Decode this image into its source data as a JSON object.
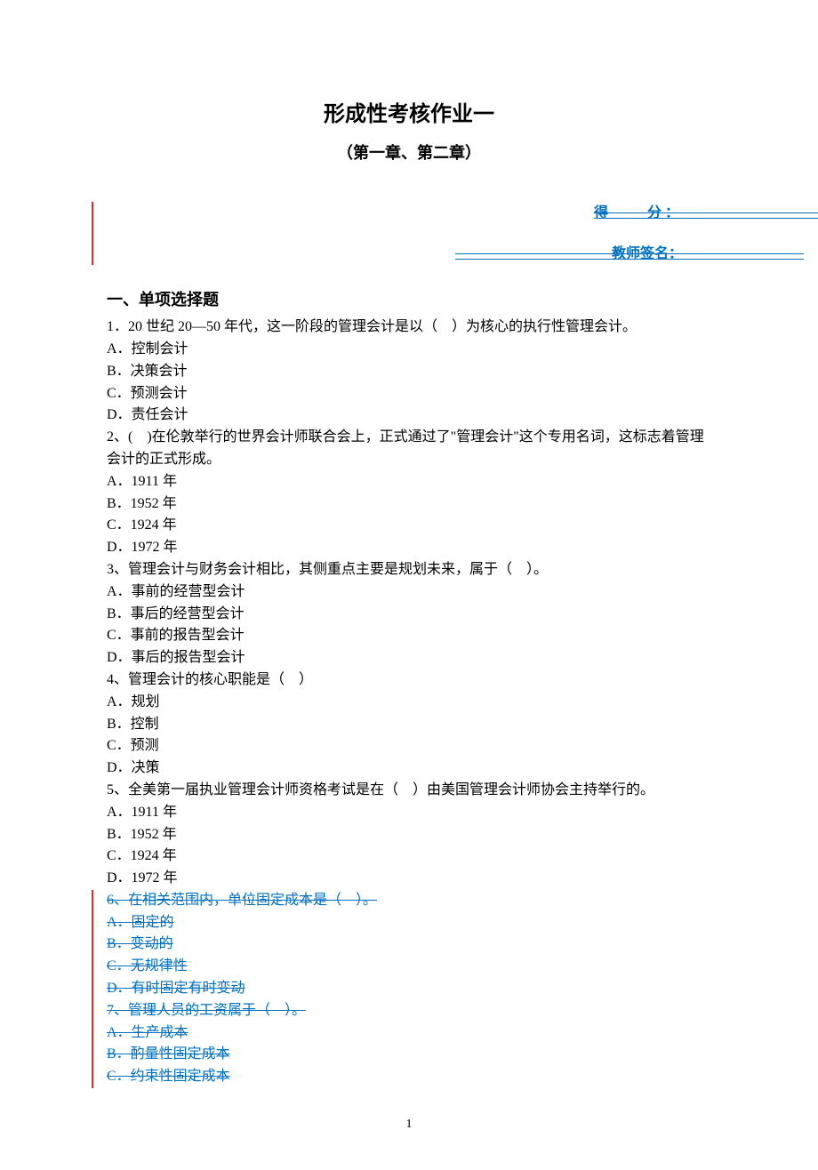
{
  "title": "形成性考核作业一",
  "subtitle": "（第一章、第二章）",
  "score_label": "得　　分：　　　　　　　　　",
  "teacher_label": "　　　　　　　　　　　教师签名：　　　　　　　　　",
  "section1": {
    "heading": "一、单项选择题",
    "q1": "1．20 世纪 20—50 年代，这一阶段的管理会计是以（　）为核心的执行性管理会计。",
    "q1a": "A．控制会计",
    "q1b": "B．决策会计",
    "q1c": "C．预测会计",
    "q1d": "D．责任会计",
    "q2": "2、(　)在伦敦举行的世界会计师联合会上，正式通过了\"管理会计\"这个专用名词，这标志着管理会计的正式形成。",
    "q2a": "A．1911 年",
    "q2b": "B．1952 年",
    "q2c": "C．1924 年",
    "q2d": "D．1972 年",
    "q3": "3、管理会计与财务会计相比，其侧重点主要是规划未来，属于（　）。",
    "q3a": "A．事前的经营型会计",
    "q3b": "B．事后的经营型会计",
    "q3c": "C．事前的报告型会计",
    "q3d": "D．事后的报告型会计",
    "q4": "4、管理会计的核心职能是（　）",
    "q4a": "A．规划",
    "q4b": "B．控制",
    "q4c": "C．预测",
    "q4d": "D．决策",
    "q5": "5、全美第一届执业管理会计师资格考试是在（　）由美国管理会计师协会主持举行的。",
    "q5a": "A．1911 年",
    "q5b": "B．1952 年",
    "q5c": "C．1924 年",
    "q5d": "D．1972 年",
    "q6": "6、在相关范围内，单位固定成本是（　）。",
    "q6a": "A．固定的",
    "q6b": "B．变动的",
    "q6c": "C．无规律性",
    "q6d": "D．有时固定有时变动",
    "q7": "7、管理人员的工资属于（　）。",
    "q7a": "A．生产成本",
    "q7b": "B．酌量性固定成本",
    "q7c": "C．约束性固定成本"
  },
  "page_number": "1"
}
